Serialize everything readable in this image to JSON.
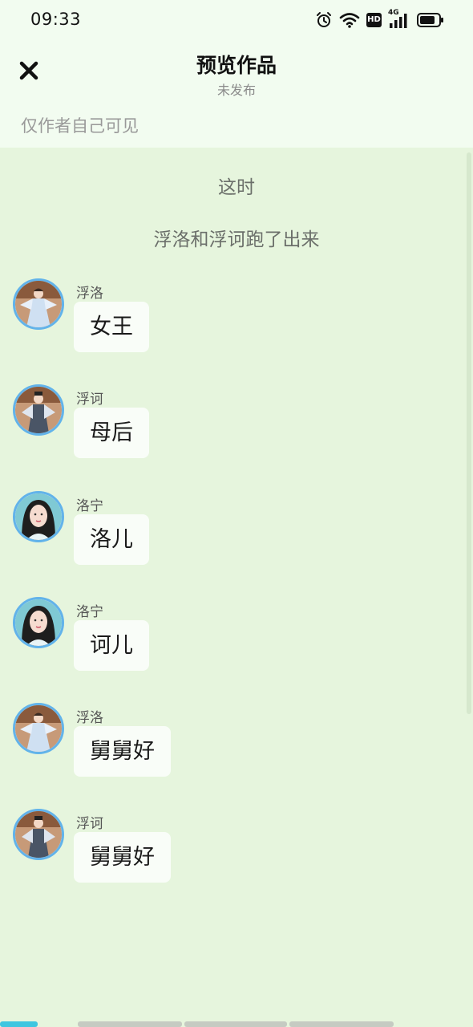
{
  "status_bar": {
    "time": "09:33",
    "icons": [
      "alarm-icon",
      "wifi-icon",
      "hd-icon",
      "4g-signal-icon",
      "battery-icon"
    ],
    "network_label": "4G",
    "hd_label": "HD"
  },
  "header": {
    "title": "预览作品",
    "subtitle": "未发布",
    "close_icon": "close-icon"
  },
  "visibility_note": "仅作者自己可见",
  "chat": {
    "narrations": [
      {
        "text": "这时"
      },
      {
        "text": "浮洛和浮诃跑了出来"
      }
    ],
    "messages": [
      {
        "sender": "浮洛",
        "text": "女王",
        "avatar": "girl-hanfu-avatar"
      },
      {
        "sender": "浮诃",
        "text": "母后",
        "avatar": "boy-hanfu-avatar"
      },
      {
        "sender": "洛宁",
        "text": "洛儿",
        "avatar": "woman-portrait-avatar"
      },
      {
        "sender": "洛宁",
        "text": "诃儿",
        "avatar": "woman-portrait-avatar"
      },
      {
        "sender": "浮洛",
        "text": "舅舅好",
        "avatar": "girl-hanfu-avatar"
      },
      {
        "sender": "浮诃",
        "text": "舅舅好",
        "avatar": "boy-hanfu-avatar"
      }
    ]
  },
  "colors": {
    "background": "#e6f5dd",
    "header_background": "#f2fcf0",
    "bubble": "#f9fdf8",
    "avatar_border": "#62b3ea",
    "progress_active": "#3ec6e0",
    "progress_inactive": "#c5cbc2"
  }
}
